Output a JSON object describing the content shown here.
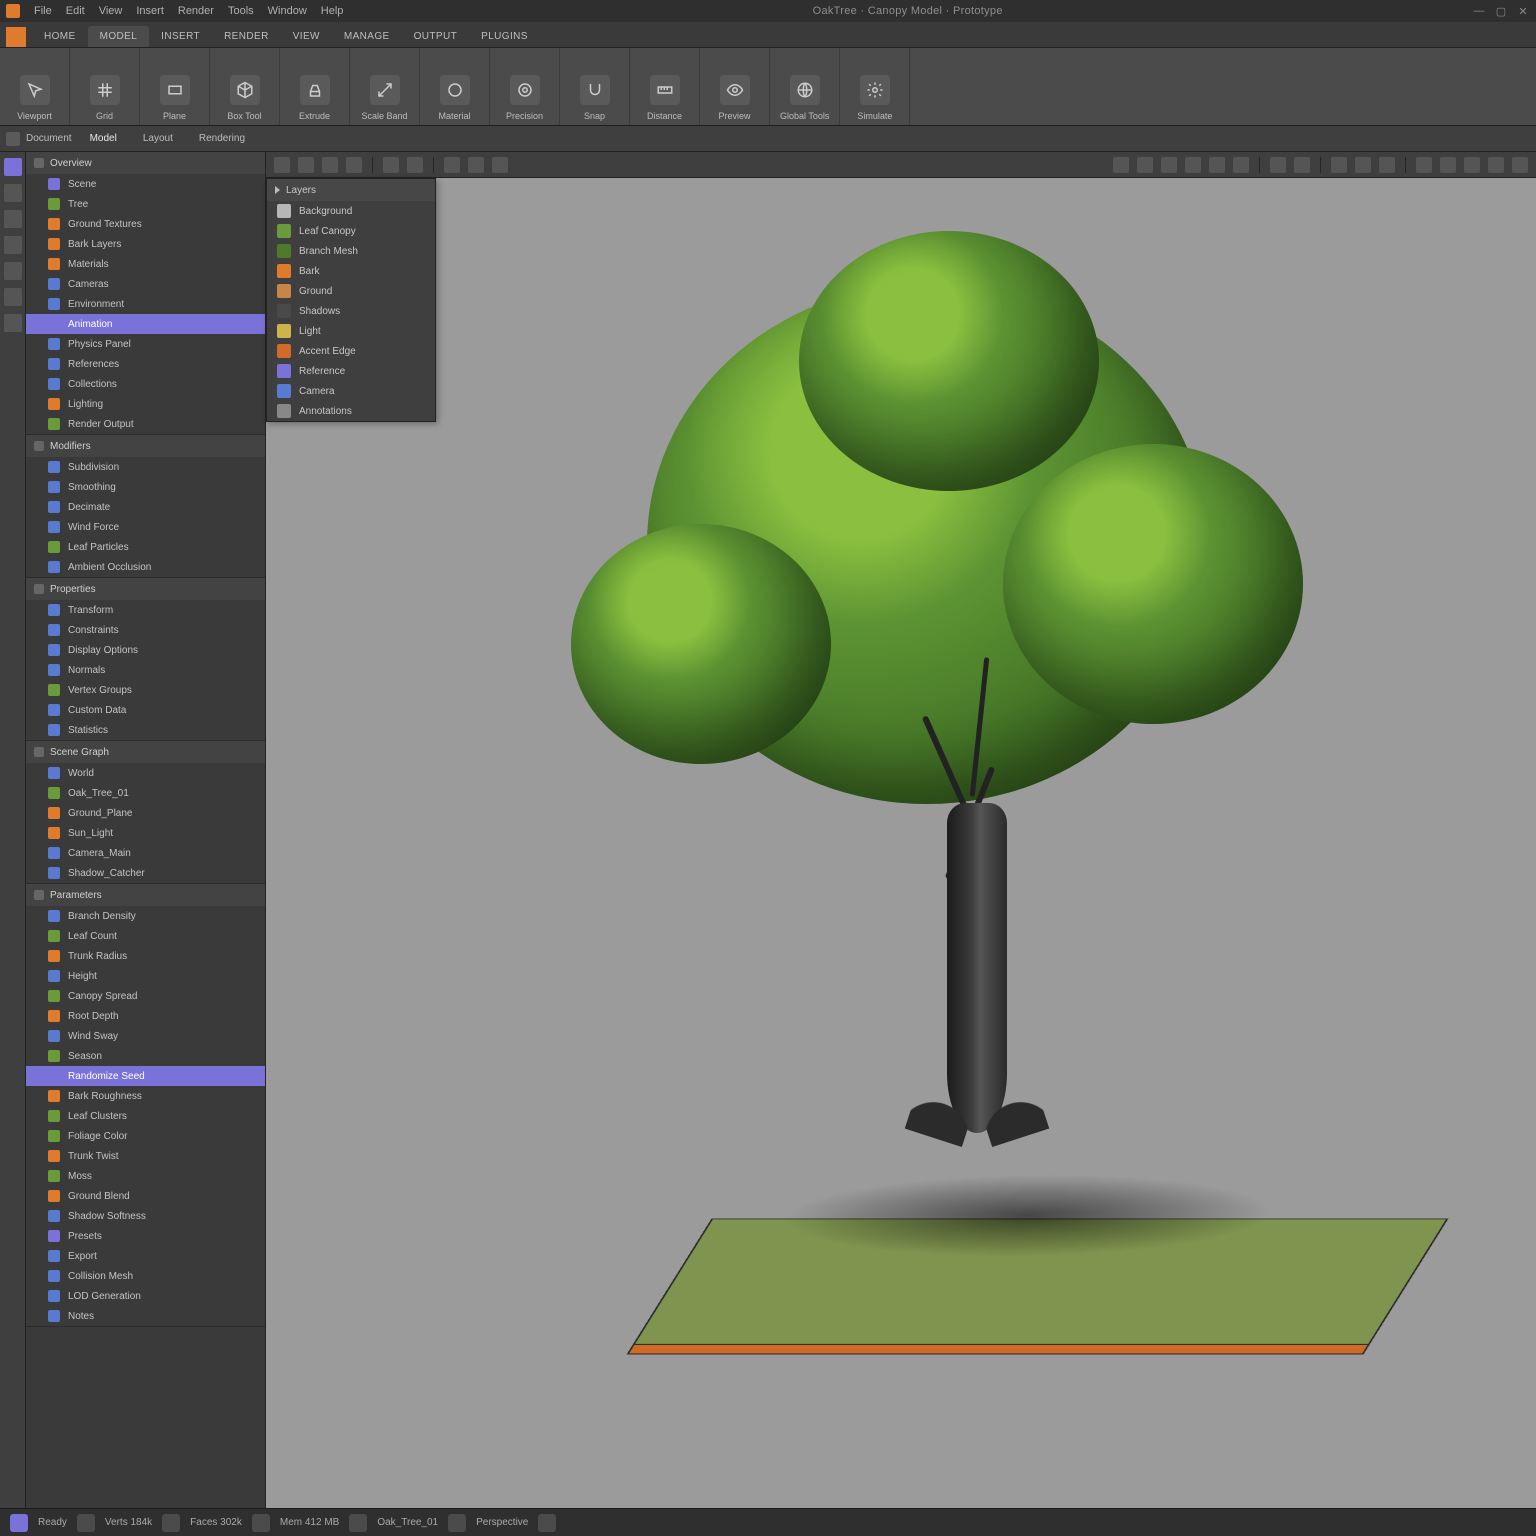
{
  "colors": {
    "accent": "#7a72d8",
    "brand": "#e07b2e",
    "leaf": "#5d9433"
  },
  "titlebar": {
    "menus": [
      "File",
      "Edit",
      "View",
      "Insert",
      "Render",
      "Tools",
      "Window",
      "Help"
    ],
    "title": "OakTree · Canopy Model · Prototype"
  },
  "ribbonTabs": [
    "HOME",
    "MODEL",
    "INSERT",
    "RENDER",
    "VIEW",
    "MANAGE",
    "OUTPUT",
    "PLUGINS"
  ],
  "ribbonActiveTab": "MODEL",
  "ribbonGroups": [
    {
      "label": "Viewport",
      "icon": "cursor"
    },
    {
      "label": "Grid",
      "icon": "grid"
    },
    {
      "label": "Plane",
      "icon": "plane"
    },
    {
      "label": "Box Tool",
      "icon": "cube"
    },
    {
      "label": "Extrude",
      "icon": "extrude"
    },
    {
      "label": "Scale Band",
      "icon": "scale"
    },
    {
      "label": "Material",
      "icon": "ball"
    },
    {
      "label": "Precision",
      "icon": "precision"
    },
    {
      "label": "Snap",
      "icon": "snap"
    },
    {
      "label": "Distance",
      "icon": "ruler"
    },
    {
      "label": "Preview",
      "icon": "eye"
    },
    {
      "label": "Global Tools",
      "icon": "globe"
    },
    {
      "label": "Simulate",
      "icon": "gear"
    }
  ],
  "substrip": {
    "crumb": "Document",
    "tabs": [
      "Model",
      "Layout",
      "Rendering"
    ]
  },
  "leftPanel": {
    "sections": [
      {
        "title": "Overview",
        "items": [
          {
            "label": "Scene",
            "icon": "pu"
          },
          {
            "label": "Tree",
            "icon": "gr"
          },
          {
            "label": "Ground Textures",
            "icon": "or"
          },
          {
            "label": "Bark Layers",
            "icon": "or"
          },
          {
            "label": "Materials",
            "icon": "or"
          },
          {
            "label": "Cameras",
            "icon": "bl"
          },
          {
            "label": "Environment",
            "icon": "bl"
          },
          {
            "label": "Animation",
            "icon": "pu",
            "sel": true
          },
          {
            "label": "Physics Panel",
            "icon": "bl"
          },
          {
            "label": "References",
            "icon": "bl"
          },
          {
            "label": "Collections",
            "icon": "bl"
          },
          {
            "label": "Lighting",
            "icon": "or"
          },
          {
            "label": "Render Output",
            "icon": "gr"
          }
        ]
      },
      {
        "title": "Modifiers",
        "items": [
          {
            "label": "Subdivision",
            "icon": "bl"
          },
          {
            "label": "Smoothing",
            "icon": "bl"
          },
          {
            "label": "Decimate",
            "icon": "bl"
          },
          {
            "label": "Wind Force",
            "icon": "bl"
          },
          {
            "label": "Leaf Particles",
            "icon": "gr"
          },
          {
            "label": "Ambient Occlusion",
            "icon": "bl"
          }
        ]
      },
      {
        "title": "Properties",
        "items": [
          {
            "label": "Transform",
            "icon": "bl"
          },
          {
            "label": "Constraints",
            "icon": "bl"
          },
          {
            "label": "Display Options",
            "icon": "bl"
          },
          {
            "label": "Normals",
            "icon": "bl"
          },
          {
            "label": "Vertex Groups",
            "icon": "gr"
          },
          {
            "label": "Custom Data",
            "icon": "bl"
          },
          {
            "label": "Statistics",
            "icon": "bl"
          }
        ]
      },
      {
        "title": "Scene Graph",
        "items": [
          {
            "label": "World",
            "icon": "bl"
          },
          {
            "label": "Oak_Tree_01",
            "icon": "gr"
          },
          {
            "label": "Ground_Plane",
            "icon": "or"
          },
          {
            "label": "Sun_Light",
            "icon": "or"
          },
          {
            "label": "Camera_Main",
            "icon": "bl"
          },
          {
            "label": "Shadow_Catcher",
            "icon": "bl"
          }
        ]
      },
      {
        "title": "Parameters",
        "items": [
          {
            "label": "Branch Density",
            "icon": "bl"
          },
          {
            "label": "Leaf Count",
            "icon": "gr"
          },
          {
            "label": "Trunk Radius",
            "icon": "or"
          },
          {
            "label": "Height",
            "icon": "bl"
          },
          {
            "label": "Canopy Spread",
            "icon": "gr"
          },
          {
            "label": "Root Depth",
            "icon": "or"
          },
          {
            "label": "Wind Sway",
            "icon": "bl"
          },
          {
            "label": "Season",
            "icon": "gr"
          },
          {
            "label": "Randomize Seed",
            "icon": "pu",
            "sel": true
          },
          {
            "label": "Bark Roughness",
            "icon": "or"
          },
          {
            "label": "Leaf Clusters",
            "icon": "gr"
          },
          {
            "label": "Foliage Color",
            "icon": "gr"
          },
          {
            "label": "Trunk Twist",
            "icon": "or"
          },
          {
            "label": "Moss",
            "icon": "gr"
          },
          {
            "label": "Ground Blend",
            "icon": "or"
          },
          {
            "label": "Shadow Softness",
            "icon": "bl"
          },
          {
            "label": "Presets",
            "icon": "pu"
          },
          {
            "label": "Export",
            "icon": "bl"
          },
          {
            "label": "Collision Mesh",
            "icon": "bl"
          },
          {
            "label": "LOD Generation",
            "icon": "bl"
          },
          {
            "label": "Notes",
            "icon": "bl"
          }
        ]
      }
    ]
  },
  "layerBox": {
    "title": "Layers",
    "items": [
      {
        "label": "Background",
        "color": "#b6b6b6"
      },
      {
        "label": "Leaf Canopy",
        "color": "#6a9a3a"
      },
      {
        "label": "Branch Mesh",
        "color": "#4f7a2a"
      },
      {
        "label": "Bark",
        "color": "#e07b2e"
      },
      {
        "label": "Ground",
        "color": "#c98545"
      },
      {
        "label": "Shadows",
        "color": "#4a4a4a"
      },
      {
        "label": "Light",
        "color": "#d0b24a"
      },
      {
        "label": "Accent Edge",
        "color": "#d06b2c"
      },
      {
        "label": "Reference",
        "color": "#7a72d8"
      },
      {
        "label": "Camera",
        "color": "#5a7ad0"
      },
      {
        "label": "Annotations",
        "color": "#888888"
      }
    ]
  },
  "viewportToolbar": {
    "left": [
      "select",
      "move",
      "rotate",
      "scale",
      "sep",
      "brush",
      "erase",
      "sep",
      "snap",
      "grid",
      "axis"
    ],
    "right": [
      "shade-flat",
      "shade-smooth",
      "wire",
      "solid",
      "material",
      "render",
      "sep",
      "camera",
      "ortho",
      "sep",
      "zoom-fit",
      "zoom-in",
      "zoom-out",
      "sep",
      "fullscreen",
      "settings",
      "layers",
      "record",
      "help"
    ]
  },
  "status": {
    "items": [
      "Ready",
      "Verts 184k",
      "Faces 302k",
      "Mem 412 MB",
      "Oak_Tree_01",
      "Perspective"
    ]
  }
}
